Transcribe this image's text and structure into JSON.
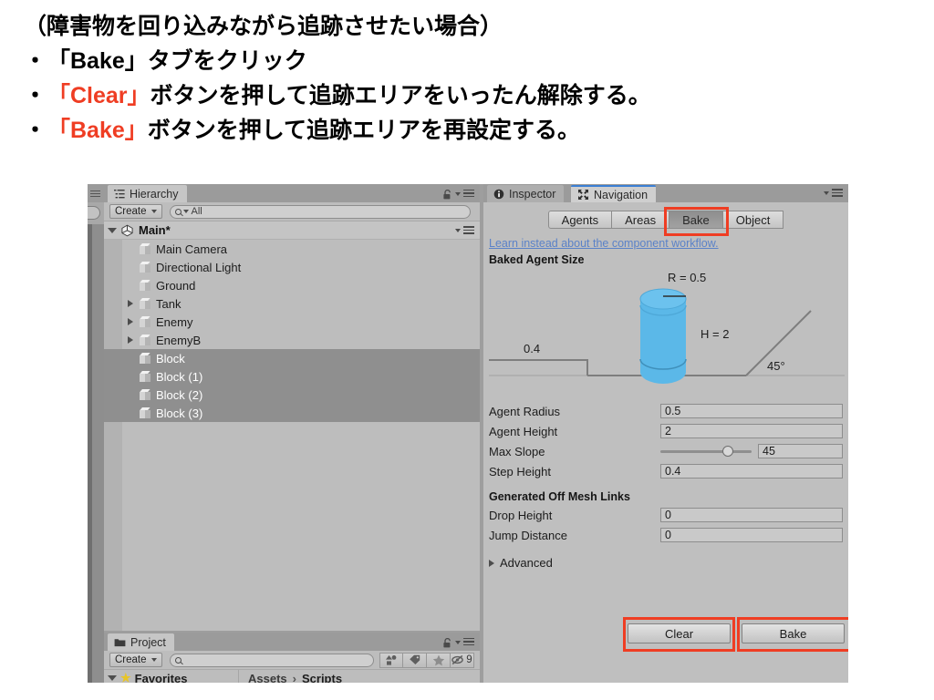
{
  "slide": {
    "lines": [
      {
        "bullet": false,
        "segments": [
          {
            "text": "（障害物を回り込みながら追跡させたい場合）",
            "color": "black"
          }
        ]
      },
      {
        "bullet": true,
        "segments": [
          {
            "text": "「Bake」",
            "color": "black"
          },
          {
            "text": "タブをクリック",
            "color": "black"
          }
        ]
      },
      {
        "bullet": true,
        "segments": [
          {
            "text": "「Clear」",
            "color": "red"
          },
          {
            "text": "ボタンを押して追跡エリアをいったん解除する。",
            "color": "black"
          }
        ]
      },
      {
        "bullet": true,
        "segments": [
          {
            "text": "「Bake」",
            "color": "red"
          },
          {
            "text": "ボタンを押して追跡エリアを再設定する。",
            "color": "black"
          }
        ]
      }
    ],
    "bullet_char": "・",
    "accent_red": "#ef3d23"
  },
  "hierarchy": {
    "tab_label": "Hierarchy",
    "tab_icon": "hierarchy-icon",
    "create_label": "Create",
    "search_placeholder": "All",
    "search_value": "",
    "root_label": "Main*",
    "items": [
      {
        "label": "Main Camera",
        "indent": 2,
        "expandable": false,
        "selected": false
      },
      {
        "label": "Directional Light",
        "indent": 2,
        "expandable": false,
        "selected": false
      },
      {
        "label": "Ground",
        "indent": 2,
        "expandable": false,
        "selected": false
      },
      {
        "label": "Tank",
        "indent": 2,
        "expandable": true,
        "selected": false
      },
      {
        "label": "Enemy",
        "indent": 2,
        "expandable": true,
        "selected": false
      },
      {
        "label": "EnemyB",
        "indent": 2,
        "expandable": true,
        "selected": false
      },
      {
        "label": "Block",
        "indent": 2,
        "expandable": false,
        "selected": true
      },
      {
        "label": "Block (1)",
        "indent": 2,
        "expandable": false,
        "selected": true
      },
      {
        "label": "Block (2)",
        "indent": 2,
        "expandable": false,
        "selected": true
      },
      {
        "label": "Block (3)",
        "indent": 2,
        "expandable": false,
        "selected": true
      }
    ]
  },
  "project": {
    "tab_label": "Project",
    "tab_icon": "folder-icon",
    "create_label": "Create",
    "search_placeholder": "",
    "favorites_label": "Favorites",
    "breadcrumb": [
      "Assets",
      "Scripts"
    ],
    "breadcrumb_sep": "›",
    "toolbar_icons": [
      {
        "name": "filter-by-type-icon",
        "glyph": "◣"
      },
      {
        "name": "filter-by-label-icon",
        "glyph": "🏷"
      },
      {
        "name": "favorite-star-icon",
        "glyph": "★"
      },
      {
        "name": "hidden-toggle-icon",
        "glyph": "⊘"
      }
    ],
    "hidden_count": "9"
  },
  "inspector": {
    "tabs": [
      {
        "label": "Inspector",
        "icon": "info-icon",
        "active": false
      },
      {
        "label": "Navigation",
        "icon": "navigation-icon",
        "active": true
      }
    ],
    "segments": [
      {
        "label": "Agents",
        "selected": false,
        "highlighted": false
      },
      {
        "label": "Areas",
        "selected": false,
        "highlighted": false
      },
      {
        "label": "Bake",
        "selected": true,
        "highlighted": true
      },
      {
        "label": "Object",
        "selected": false,
        "highlighted": false
      }
    ],
    "learn_link": "Learn instead about the component workflow.",
    "baked_agent_size_title": "Baked Agent Size",
    "diagram": {
      "radius_label": "R = 0.5",
      "height_label": "H = 2",
      "step_label": "0.4",
      "slope_label": "45°",
      "agent_color": "#5bb8e8"
    },
    "properties": [
      {
        "label": "Agent Radius",
        "value": "0.5",
        "type": "field"
      },
      {
        "label": "Agent Height",
        "value": "2",
        "type": "field"
      },
      {
        "label": "Max Slope",
        "value": "45",
        "type": "slider"
      },
      {
        "label": "Step Height",
        "value": "0.4",
        "type": "field"
      }
    ],
    "offmesh_group_title": "Generated Off Mesh Links",
    "offmesh_properties": [
      {
        "label": "Drop Height",
        "value": "0",
        "type": "field"
      },
      {
        "label": "Jump Distance",
        "value": "0",
        "type": "field"
      }
    ],
    "advanced_label": "Advanced",
    "buttons": [
      {
        "label": "Clear",
        "highlighted": true
      },
      {
        "label": "Bake",
        "highlighted": true
      }
    ],
    "highlight_color": "#ef3d23"
  }
}
